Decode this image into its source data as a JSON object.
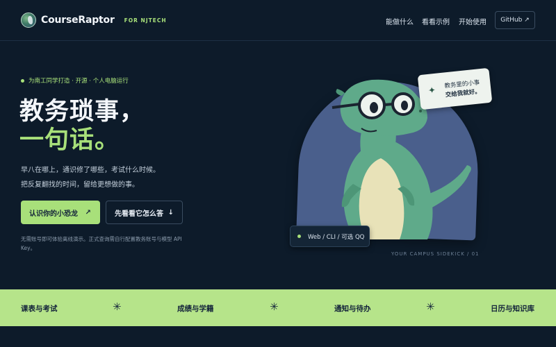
{
  "header": {
    "brand": "CourseRaptor",
    "tagline": "FOR NJTECH",
    "nav": [
      "能做什么",
      "看看示例",
      "开始使用"
    ],
    "github_label": "GitHub ↗"
  },
  "hero": {
    "kicker": "为南工同学打造 · 开源 · 个人电脑运行",
    "headline_line1": "教务琐事，",
    "headline_line2": "一句话。",
    "desc_line1": "早八在哪上，通识修了哪些，考试什么时候。",
    "desc_line2": "把反复翻找的时间，留给更想做的事。",
    "primary_button": "认识你的小恐龙",
    "primary_arrow": "↗",
    "secondary_button": "先看看它怎么答",
    "secondary_arrow": "↓",
    "note": "无需账号即可体验离线演示。正式查询需自行配置教务账号与模型 API Key。"
  },
  "illustration": {
    "bubble_line1": "教务里的小事",
    "bubble_line2": "交给我就好。",
    "bubble_icon": "sparkle-icon",
    "pill_label": "Web / CLI / 可选 QQ",
    "caption": "YOUR CAMPUS SIDEKICK / 01"
  },
  "features": [
    "课表与考试",
    "成绩与学籍",
    "通知与待办",
    "日历与知识库"
  ],
  "colors": {
    "background": "#0d1b2a",
    "accent": "#a8e07a",
    "band": "#b6e48a",
    "arch": "#4a5f8c",
    "dino": "#5faa8a"
  }
}
